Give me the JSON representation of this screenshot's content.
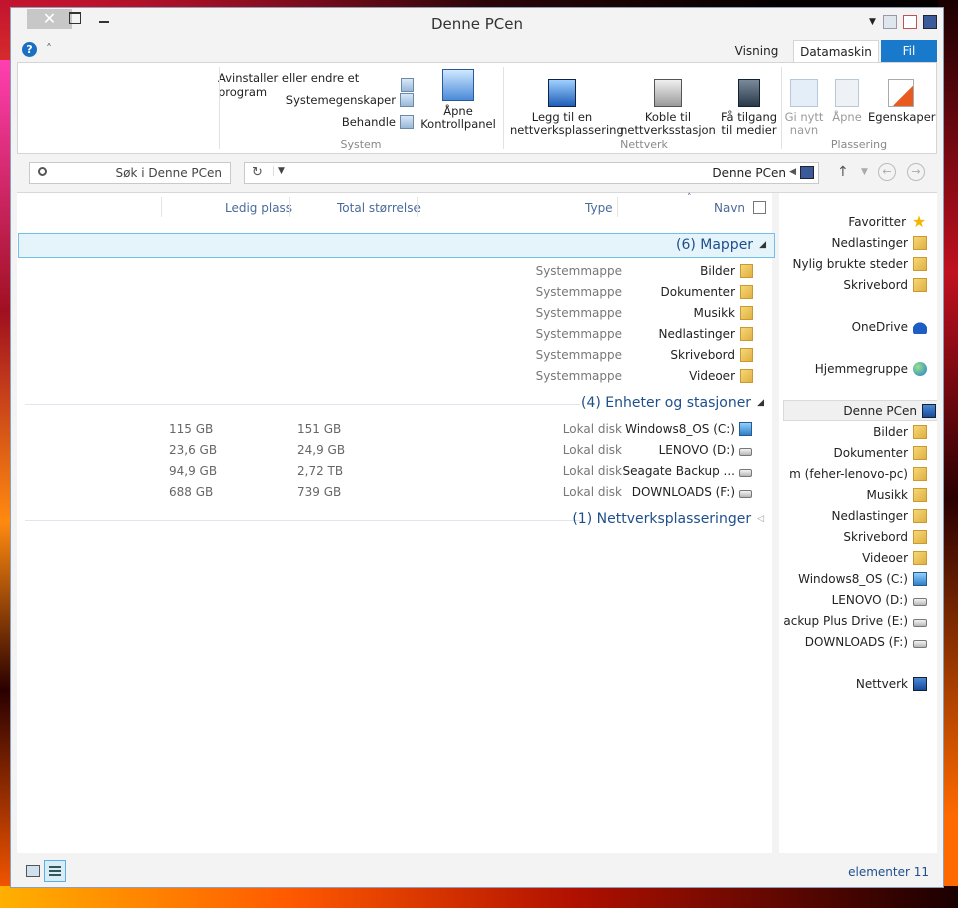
{
  "window": {
    "title": "Denne PCen"
  },
  "tabs": {
    "visning": "Visning",
    "datamaskin": "Datamaskin",
    "fil": "Fil"
  },
  "ribbon": {
    "system": {
      "label": "System",
      "uninstall": "Avinstaller eller endre et program",
      "system_props": "Systemegenskaper",
      "manage": "Behandle",
      "open_cp_line1": "Åpne",
      "open_cp_line2": "Kontrollpanel"
    },
    "network": {
      "label": "Nettverk",
      "add_loc_line1": "Legg til en",
      "add_loc_line2": "nettverksplassering",
      "map_drive_line1": "Koble til",
      "map_drive_line2": "nettverksstasjon",
      "access_media_line1": "Få tilgang",
      "access_media_line2": "til medier"
    },
    "location": {
      "label": "Plassering",
      "rename_line1": "Gi nytt",
      "rename_line2": "navn",
      "open": "Åpne",
      "properties": "Egenskaper"
    }
  },
  "search": {
    "placeholder": "Søk i Denne PCen"
  },
  "address": {
    "path": "Denne PCen"
  },
  "columns": {
    "free": "Ledig plass",
    "total": "Total størrelse",
    "type": "Type",
    "name": "Navn"
  },
  "groups": {
    "folders": {
      "header": "(6) Mapper",
      "expanded": true
    },
    "devices": {
      "header": "(4) Enheter og stasjoner",
      "expanded": true
    },
    "network": {
      "header": "(1) Nettverksplasseringer",
      "expanded": false
    }
  },
  "folders": [
    {
      "name": "Bilder",
      "type": "Systemmappe"
    },
    {
      "name": "Dokumenter",
      "type": "Systemmappe"
    },
    {
      "name": "Musikk",
      "type": "Systemmappe"
    },
    {
      "name": "Nedlastinger",
      "type": "Systemmappe"
    },
    {
      "name": "Skrivebord",
      "type": "Systemmappe"
    },
    {
      "name": "Videoer",
      "type": "Systemmappe"
    }
  ],
  "drives": [
    {
      "name": "Windows8_OS (C:)",
      "type": "Lokal disk",
      "free": "115 GB",
      "total": "151 GB"
    },
    {
      "name": "LENOVO (D:)",
      "type": "Lokal disk",
      "free": "23,6 GB",
      "total": "24,9 GB"
    },
    {
      "name": "Seagate Backup ...",
      "type": "Lokal disk",
      "free": "94,9 GB",
      "total": "2,72 TB"
    },
    {
      "name": "DOWNLOADS (F:)",
      "type": "Lokal disk",
      "free": "688 GB",
      "total": "739 GB"
    }
  ],
  "navpane": {
    "favorites": "Favoritter",
    "fav_items": [
      "Nedlastinger",
      "Nylig brukte steder",
      "Skrivebord"
    ],
    "onedrive": "OneDrive",
    "homegroup": "Hjemmegruppe",
    "thispc": "Denne PCen",
    "pc_items": [
      "Bilder",
      "Dokumenter",
      "m (feher-lenovo-pc)",
      "Musikk",
      "Nedlastinger",
      "Skrivebord",
      "Videoer",
      "Windows8_OS (C:)",
      "LENOVO (D:)",
      "ackup Plus Drive (E:)",
      "DOWNLOADS (F:)"
    ],
    "network": "Nettverk"
  },
  "status": {
    "count": "elementer 11"
  },
  "colors": {
    "accent": "#1979ca",
    "group_header": "#1e4e8c",
    "selection": "#e5f3fb"
  }
}
